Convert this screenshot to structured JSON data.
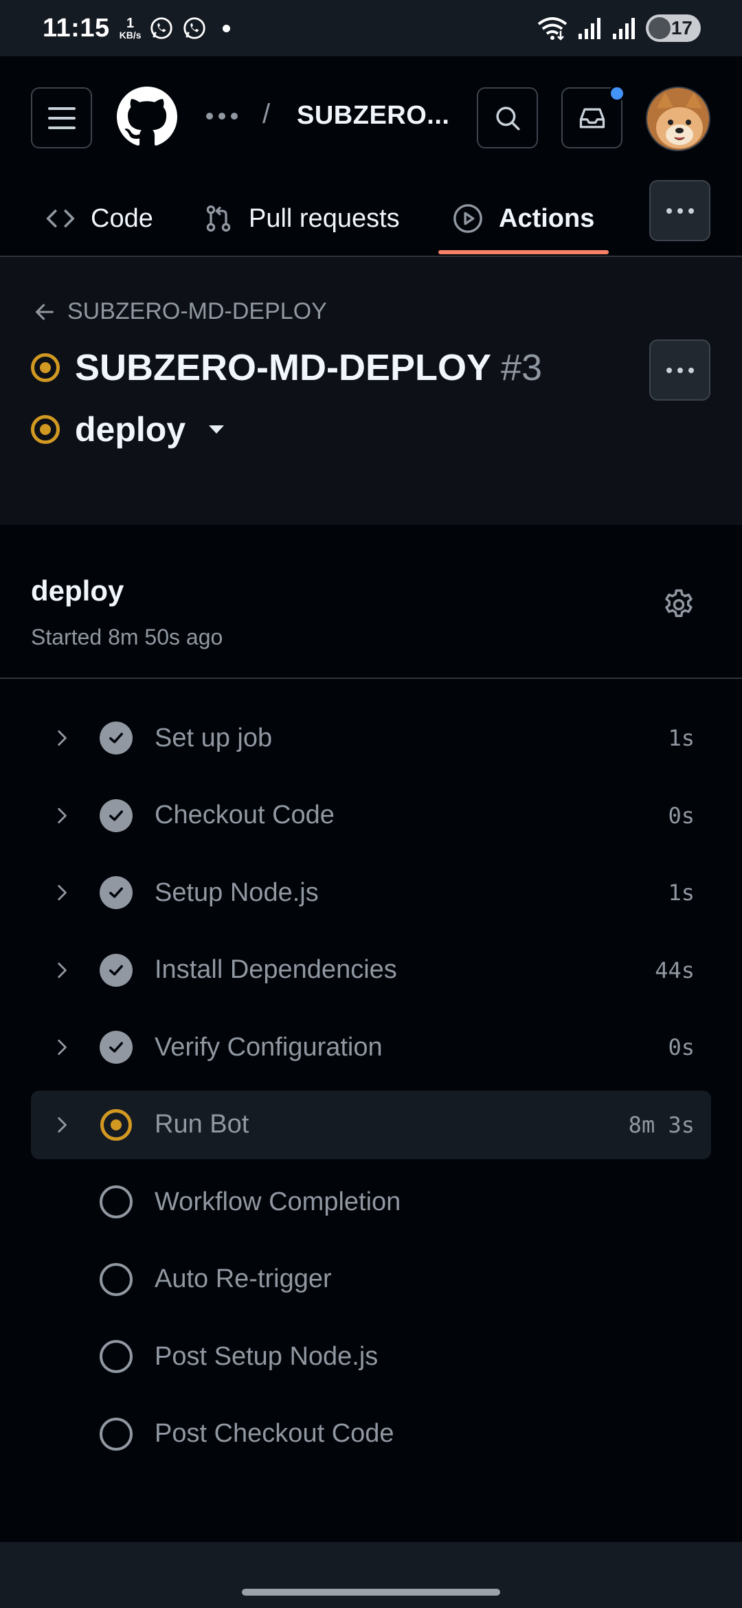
{
  "status_bar": {
    "time": "11:15",
    "net_speed_value": "1",
    "net_speed_unit": "KB/s",
    "battery": "17"
  },
  "header": {
    "breadcrumb_more": "...",
    "breadcrumb_separator": "/",
    "repo_name": "SUBZERO...",
    "tabs": [
      {
        "label": "Code",
        "icon": "code-icon",
        "selected": false
      },
      {
        "label": "Pull requests",
        "icon": "git-pull-request-icon",
        "selected": false
      },
      {
        "label": "Actions",
        "icon": "play-icon",
        "selected": true
      }
    ]
  },
  "run": {
    "back_label": "SUBZERO-MD-DEPLOY",
    "workflow_name": "SUBZERO-MD-DEPLOY",
    "run_number": "#3",
    "job_selector": "deploy",
    "status": "in-progress"
  },
  "job": {
    "title": "deploy",
    "started": "Started 8m 50s ago",
    "steps": [
      {
        "label": "Set up job",
        "duration": "1s",
        "status": "success",
        "expandable": true
      },
      {
        "label": "Checkout Code",
        "duration": "0s",
        "status": "success",
        "expandable": true
      },
      {
        "label": "Setup Node.js",
        "duration": "1s",
        "status": "success",
        "expandable": true
      },
      {
        "label": "Install Dependencies",
        "duration": "44s",
        "status": "success",
        "expandable": true
      },
      {
        "label": "Verify Configuration",
        "duration": "0s",
        "status": "success",
        "expandable": true
      },
      {
        "label": "Run Bot",
        "duration": "8m 3s",
        "status": "in-progress",
        "expandable": true
      },
      {
        "label": "Workflow Completion",
        "duration": "",
        "status": "pending",
        "expandable": false
      },
      {
        "label": "Auto Re-trigger",
        "duration": "",
        "status": "pending",
        "expandable": false
      },
      {
        "label": "Post Setup Node.js",
        "duration": "",
        "status": "pending",
        "expandable": false
      },
      {
        "label": "Post Checkout Code",
        "duration": "",
        "status": "pending",
        "expandable": false
      }
    ]
  },
  "colors": {
    "background": "#010409",
    "surface": "#0d1117",
    "in_progress": "#d29922",
    "tab_underline": "#f78166",
    "notification": "#4493f8",
    "muted": "#9198a1"
  }
}
